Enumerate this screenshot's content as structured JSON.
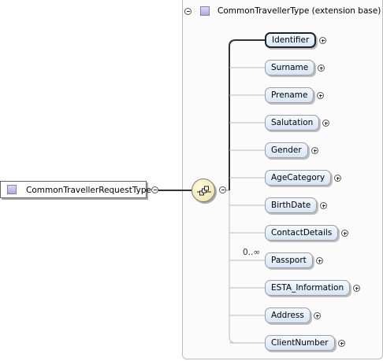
{
  "root": {
    "label": "CommonTravellerRequestType",
    "type_icon": "complex-type-icon"
  },
  "extension": {
    "title": "CommonTravellerType (extension base)",
    "type_icon": "complex-type-icon"
  },
  "compositor": {
    "kind": "sequence",
    "icon": "sequence-compositor-icon"
  },
  "elements": [
    {
      "label": "Identifier",
      "selected": true
    },
    {
      "label": "Surname"
    },
    {
      "label": "Prename"
    },
    {
      "label": "Salutation"
    },
    {
      "label": "Gender"
    },
    {
      "label": "AgeCategory"
    },
    {
      "label": "BirthDate"
    },
    {
      "label": "ContactDetails"
    },
    {
      "label": "Passport",
      "occurrence": "0..∞"
    },
    {
      "label": "ESTA_Information"
    },
    {
      "label": "Address"
    },
    {
      "label": "ClientNumber"
    }
  ],
  "colors": {
    "element_fill": "#d6e5f6",
    "compositor_fill": "#f0df9a",
    "type_icon": "#b7a5e0"
  }
}
